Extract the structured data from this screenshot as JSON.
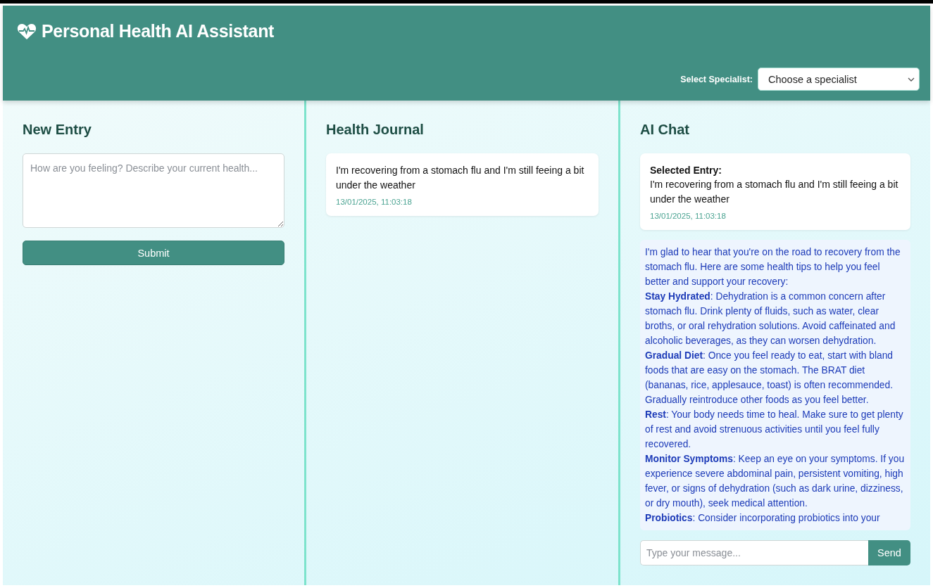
{
  "header": {
    "title": "Personal Health AI Assistant",
    "specialist_label": "Select Specialist:",
    "specialist_select": "Choose a specialist"
  },
  "new_entry": {
    "heading": "New Entry",
    "placeholder": "How are you feeling? Describe your current health...",
    "submit": "Submit"
  },
  "journal": {
    "heading": "Health Journal",
    "entries": [
      {
        "text": "I'm recovering from a stomach flu and I'm still feeing a bit under the weather",
        "timestamp": "13/01/2025, 11:03:18"
      }
    ]
  },
  "chat": {
    "heading": "AI Chat",
    "selected_entry": {
      "label": "Selected Entry:",
      "text": "I'm recovering from a stomach flu and I'm still feeing a bit under the weather",
      "timestamp": "13/01/2025, 11:03:18"
    },
    "messages": [
      {
        "kind": "assistant",
        "paragraphs": [
          "I'm glad to hear that you're on the road to recovery from the stomach flu. Here are some health tips to help you feel better and support your recovery:",
          "**Stay Hydrated**: Dehydration is a common concern after stomach flu. Drink plenty of fluids, such as water, clear broths, or oral rehydration solutions. Avoid caffeinated and alcoholic beverages, as they can worsen dehydration.",
          "**Gradual Diet**: Once you feel ready to eat, start with bland foods that are easy on the stomach. The BRAT diet (bananas, rice, applesauce, toast) is often recommended. Gradually reintroduce other foods as you feel better.",
          "**Rest**: Your body needs time to heal. Make sure to get plenty of rest and avoid strenuous activities until you feel fully recovered.",
          "**Monitor Symptoms**: Keep an eye on your symptoms. If you experience severe abdominal pain, persistent vomiting, high fever, or signs of dehydration (such as dark urine, dizziness, or dry mouth), seek medical attention.",
          "**Probiotics**: Consider incorporating probiotics into your"
        ]
      }
    ],
    "input": {
      "placeholder": "Type your message..."
    },
    "send": "Send"
  }
}
